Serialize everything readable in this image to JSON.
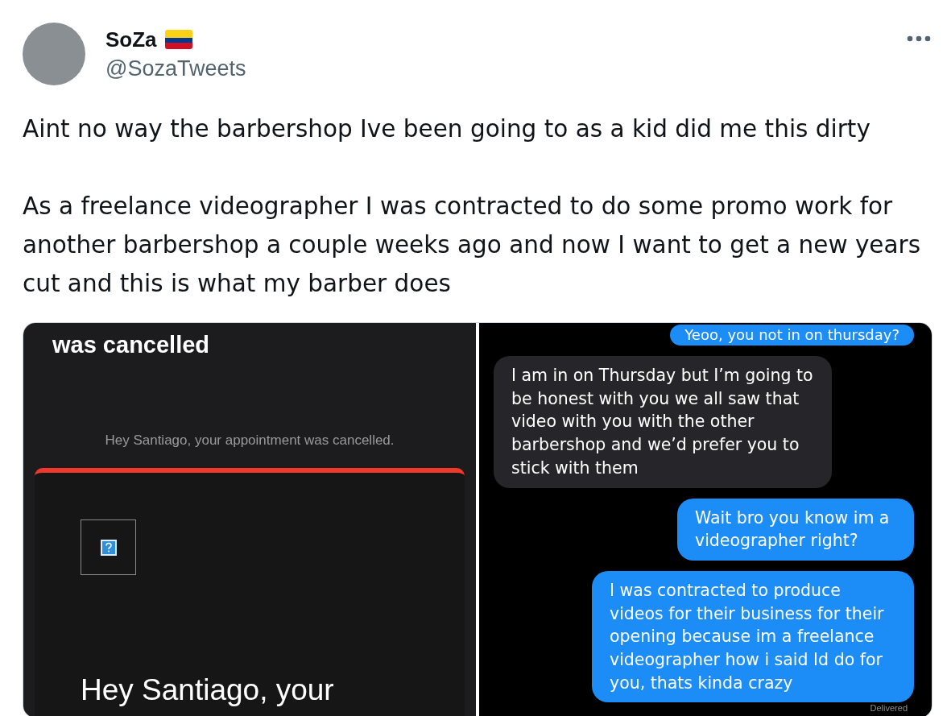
{
  "author": {
    "name": "SoZa",
    "handle": "@SozaTweets"
  },
  "tweet_text": [
    "Aint no way the barbershop Ive been going to as a kid did me this dirty",
    "As a freelance videographer I was contracted to do some promo work for another barbershop a couple weeks ago and now I want to get a new years cut and this is what my barber does"
  ],
  "email": {
    "title": "was cancelled",
    "preview": "Hey Santiago, your appointment was cancelled.",
    "heading": "Hey Santiago, your"
  },
  "messages": [
    {
      "kind": "sent",
      "text": "Yeoo, you not in on thursday?"
    },
    {
      "kind": "received",
      "text": "I am in on Thursday but I’m going to be honest with you we all saw that video with you with the other barbershop and we’d prefer you to stick with them"
    },
    {
      "kind": "sent",
      "text": "Wait bro you know im a videographer right?"
    },
    {
      "kind": "sent",
      "text": "I was contracted to produce videos for their business for their opening because im a freelance videographer how i said Id do for you, thats kinda crazy"
    }
  ],
  "status": "Delivered"
}
